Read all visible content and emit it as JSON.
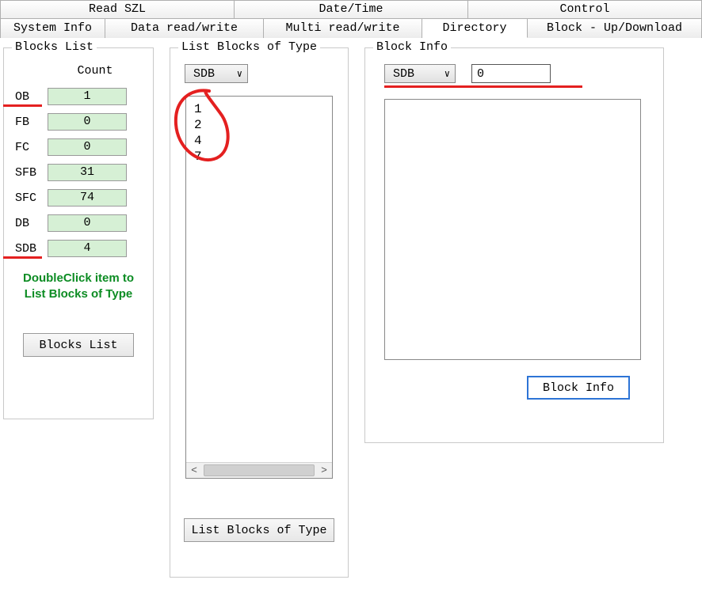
{
  "tabsRow1": {
    "readSZL": "Read SZL",
    "datetime": "Date/Time",
    "control": "Control"
  },
  "tabsRow2": {
    "sysinfo": "System Info",
    "datarw": "Data read/write",
    "multirw": "Multi read/write",
    "dir": "Directory",
    "blockud": "Block - Up/Download"
  },
  "blocksList": {
    "title": "Blocks List",
    "countHeader": "Count",
    "rows": [
      {
        "label": "OB",
        "count": "1"
      },
      {
        "label": "FB",
        "count": "0"
      },
      {
        "label": "FC",
        "count": "0"
      },
      {
        "label": "SFB",
        "count": "31"
      },
      {
        "label": "SFC",
        "count": "74"
      },
      {
        "label": "DB",
        "count": "0"
      },
      {
        "label": "SDB",
        "count": "4"
      }
    ],
    "hint": "DoubleClick item to List Blocks of Type",
    "buttonLabel": "Blocks List"
  },
  "listBlocks": {
    "title": "List Blocks of Type",
    "selectedType": "SDB",
    "items": [
      "1",
      "2",
      "4",
      "7"
    ],
    "buttonLabel": "List Blocks of Type"
  },
  "blockInfo": {
    "title": "Block Info",
    "selectedType": "SDB",
    "number": "0",
    "buttonLabel": "Block Info"
  }
}
